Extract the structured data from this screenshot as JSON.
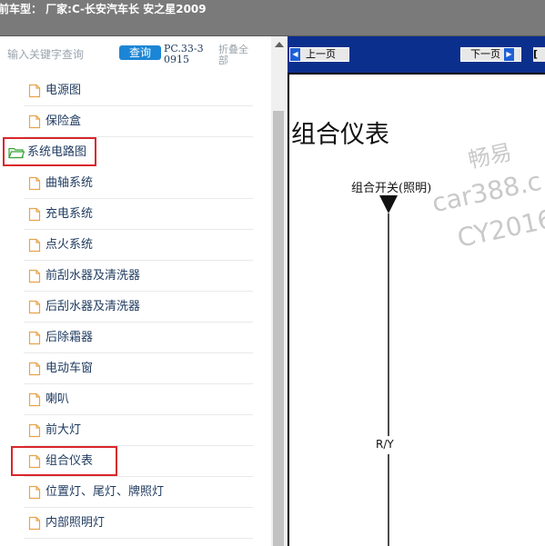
{
  "topbar": {
    "title": "前车型： 厂家:C-长安汽车长 安之星2009"
  },
  "search": {
    "placeholder": "输入关键字查询",
    "button_label": "查询",
    "code": "PC.33-30915",
    "collapse_label": "折叠全部"
  },
  "tree": {
    "items": [
      {
        "label": "电源图",
        "type": "file"
      },
      {
        "label": "保险盒",
        "type": "file"
      },
      {
        "label": "系统电路图",
        "type": "folder",
        "expanded": true,
        "highlighted": true
      },
      {
        "label": "曲轴系统",
        "type": "file"
      },
      {
        "label": "充电系统",
        "type": "file"
      },
      {
        "label": "点火系统",
        "type": "file"
      },
      {
        "label": "前刮水器及清洗器",
        "type": "file"
      },
      {
        "label": "后刮水器及清洗器",
        "type": "file"
      },
      {
        "label": "后除霜器",
        "type": "file"
      },
      {
        "label": "电动车窗",
        "type": "file"
      },
      {
        "label": "喇叭",
        "type": "file"
      },
      {
        "label": "前大灯",
        "type": "file"
      },
      {
        "label": "组合仪表",
        "type": "file",
        "highlighted": true
      },
      {
        "label": "位置灯、尾灯、牌照灯",
        "type": "file"
      },
      {
        "label": "内部照明灯",
        "type": "file"
      }
    ]
  },
  "viewer": {
    "prev_label": "上一页",
    "next_label": "下一页",
    "extra_label": "[",
    "diagram_title": "组合仪表",
    "switch_label": "组合开关(照明)",
    "wire_label": "R/Y",
    "watermark": [
      "畅易",
      "car388.c",
      "CY2016"
    ]
  },
  "colors": {
    "topbar_bg": "#7a7a7a",
    "nav_bar_bg": "#0b2f8c",
    "search_button_bg": "#1c86d6",
    "highlight_border": "#d9262b",
    "folder_icon": "#3aa63a",
    "file_icon": "#e8a34a"
  }
}
